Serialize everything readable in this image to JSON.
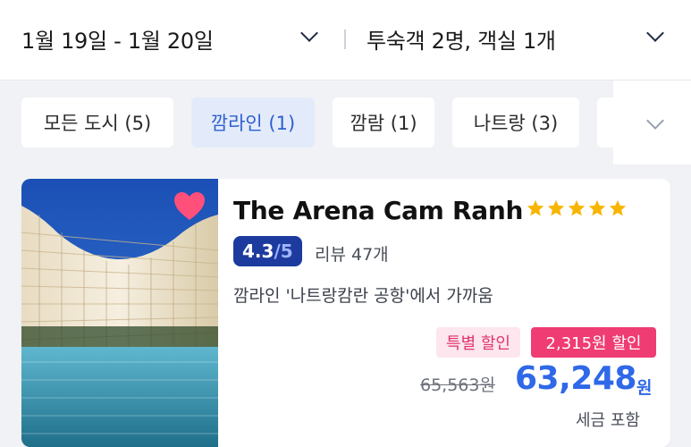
{
  "search": {
    "date_range": "1월 19일 - 1월 20일",
    "guests": "투숙객 2명, 객실 1개"
  },
  "filters": [
    {
      "label": "모든 도시 (5)",
      "selected": false
    },
    {
      "label": "깜라인 (1)",
      "selected": true
    },
    {
      "label": "깜람 (1)",
      "selected": false
    },
    {
      "label": "나트랑 (3)",
      "selected": false
    }
  ],
  "hotel": {
    "name": "The Arena Cam Ranh",
    "star_rating": 5,
    "rating_score": "4.3",
    "rating_max": "/5",
    "reviews": "리뷰 47개",
    "location": "깜라인 '나트랑캄란 공항'에서 가까움",
    "tag_special": "특별 할인",
    "tag_discount": "2,315원 할인",
    "old_price": "65,563원",
    "new_price": "63,248",
    "currency": "원",
    "tax_note": "세금 포함",
    "favorite": true
  },
  "colors": {
    "accent_blue": "#2f68e8",
    "rating_badge": "#1d3b9e",
    "star": "#f7b500",
    "heart": "#ff4f7b",
    "discount_pink": "#ef3c72"
  },
  "icons": {
    "heart": "heart-icon",
    "star": "star-icon",
    "dropdown": "chevron-down-icon"
  }
}
